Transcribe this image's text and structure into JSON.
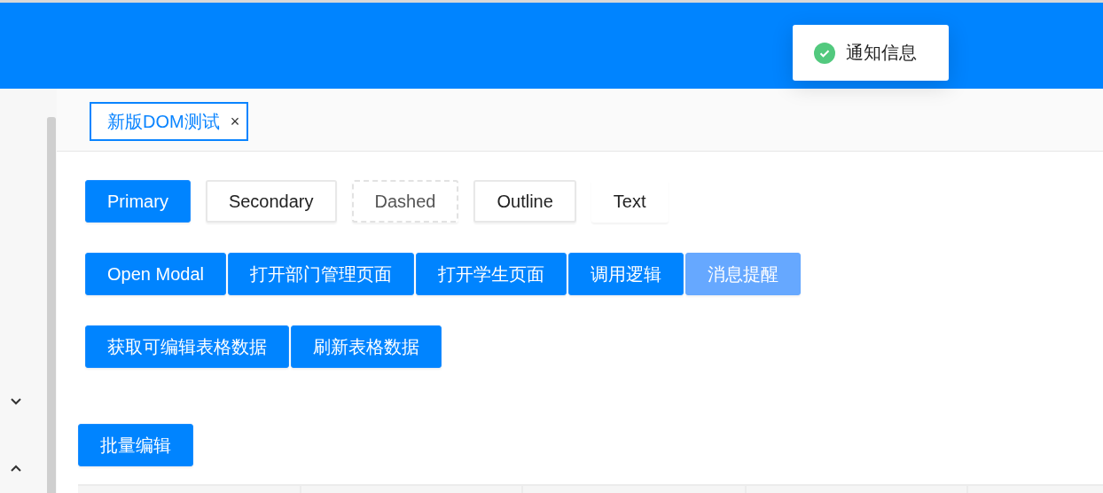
{
  "notification": {
    "kind": "success",
    "message": "通知信息"
  },
  "tabs": [
    {
      "label": "新版DOM测试",
      "selected": true,
      "close": "×"
    }
  ],
  "button_rows": [
    [
      {
        "label": "Primary",
        "kind": "primary",
        "disabled": false
      },
      {
        "label": "Secondary",
        "kind": "secondary",
        "disabled": false
      },
      {
        "label": "Dashed",
        "kind": "dashed",
        "disabled": false
      },
      {
        "label": "Outline",
        "kind": "outline",
        "disabled": false
      },
      {
        "label": "Text",
        "kind": "text",
        "disabled": false
      }
    ],
    [
      {
        "label": "Open Modal",
        "kind": "primary",
        "disabled": false
      },
      {
        "label": "打开部门管理页面",
        "kind": "primary",
        "disabled": false
      },
      {
        "label": "打开学生页面",
        "kind": "primary",
        "disabled": false
      },
      {
        "label": "调用逻辑",
        "kind": "primary",
        "disabled": false
      },
      {
        "label": "消息提醒",
        "kind": "primary",
        "disabled": true
      }
    ],
    [
      {
        "label": "获取可编辑表格数据",
        "kind": "primary",
        "disabled": false
      },
      {
        "label": "刷新表格数据",
        "kind": "primary",
        "disabled": false
      }
    ]
  ],
  "batch_button": {
    "label": "批量编辑",
    "kind": "primary",
    "disabled": false
  }
}
